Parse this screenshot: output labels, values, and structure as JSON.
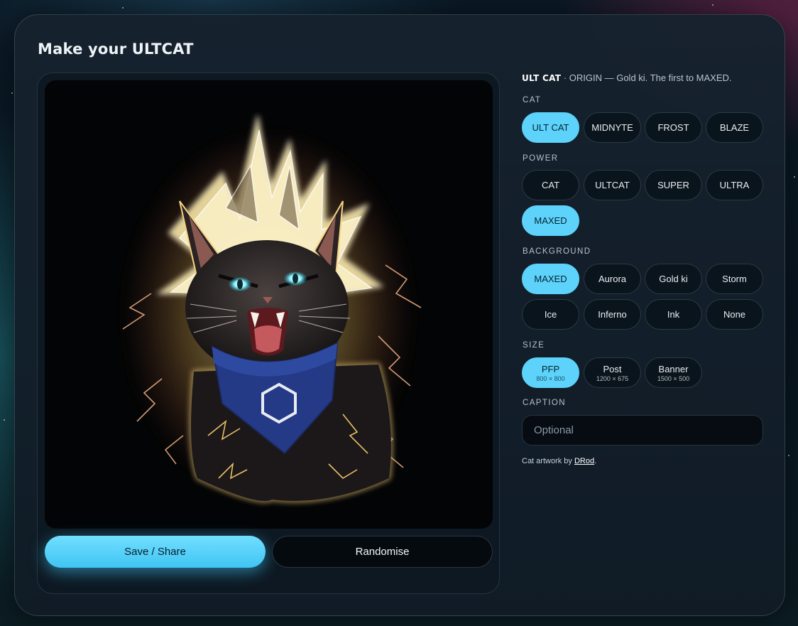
{
  "title": "Make your ULTCAT",
  "description": {
    "name": "ULT CAT",
    "text": " · ORIGIN — Gold ki. The first to MAXED."
  },
  "sections": {
    "cat": {
      "label": "CAT",
      "options": [
        "ULT CAT",
        "MIDNYTE",
        "FROST",
        "BLAZE"
      ],
      "selected": "ULT CAT"
    },
    "power": {
      "label": "POWER",
      "options": [
        "CAT",
        "ULTCAT",
        "SUPER",
        "ULTRA",
        "MAXED"
      ],
      "selected": "MAXED"
    },
    "background": {
      "label": "BACKGROUND",
      "options": [
        "MAXED",
        "Aurora",
        "Gold ki",
        "Storm",
        "Ice",
        "Inferno",
        "Ink",
        "None"
      ],
      "selected": "MAXED"
    },
    "size": {
      "label": "SIZE",
      "options": [
        {
          "label": "PFP",
          "dims": "800 × 800"
        },
        {
          "label": "Post",
          "dims": "1200 × 675"
        },
        {
          "label": "Banner",
          "dims": "1500 × 500"
        }
      ],
      "selected": "PFP"
    },
    "caption": {
      "label": "CAPTION",
      "placeholder": "Optional",
      "value": ""
    }
  },
  "credit": {
    "prefix": "Cat artwork by ",
    "link": "DRod",
    "suffix": "."
  },
  "buttons": {
    "save": "Save / Share",
    "randomise": "Randomise"
  },
  "icons": [
    "hexagon-icon"
  ],
  "colors": {
    "accent": "#5dd3fb",
    "panel_bg": "#16222e",
    "canvas_bg": "#030405",
    "aura": "#f6d27a",
    "bandana": "#2a3f8c"
  }
}
